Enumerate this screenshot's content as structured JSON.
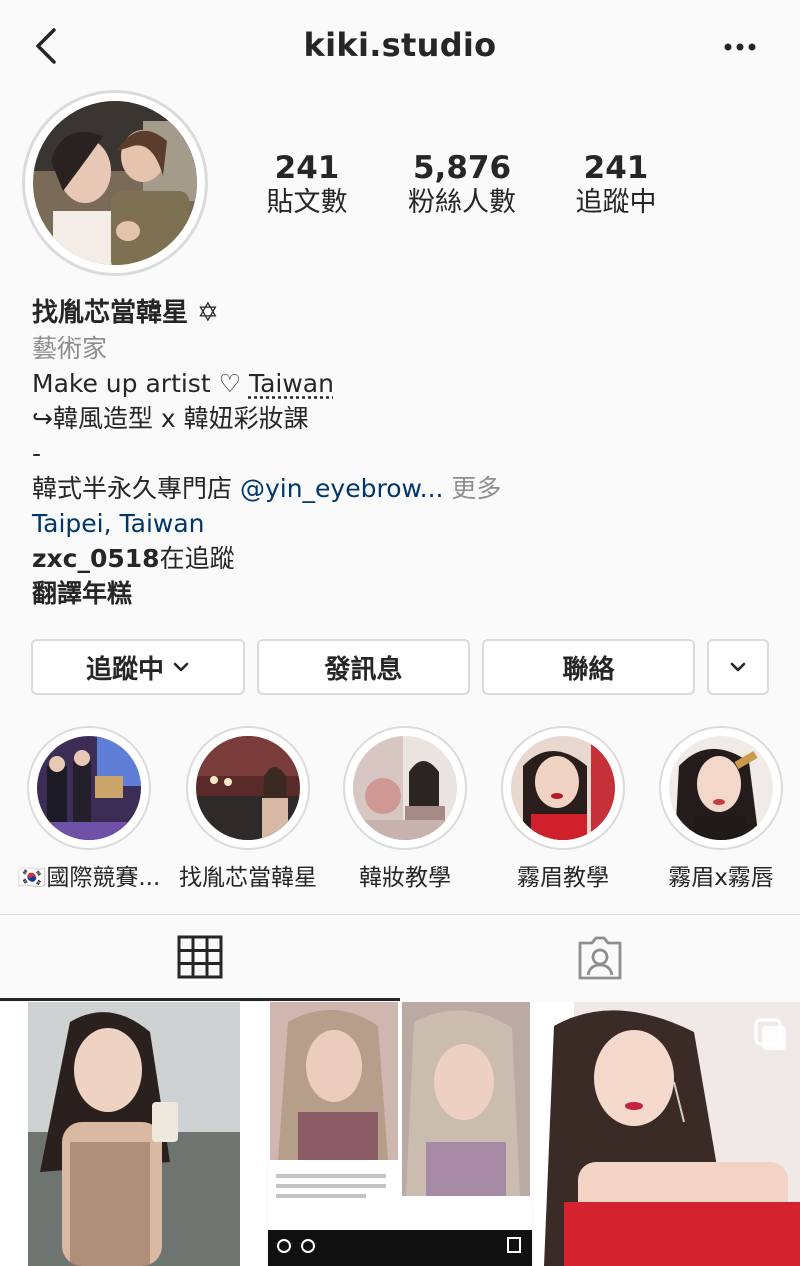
{
  "header": {
    "username": "kiki.studio"
  },
  "stats": [
    {
      "value": "241",
      "label": "貼文數"
    },
    {
      "value": "5,876",
      "label": "粉絲人數"
    },
    {
      "value": "241",
      "label": "追蹤中"
    }
  ],
  "bio": {
    "name": "找胤芯當韓星 ✡",
    "category": "藝術家",
    "line1_a": "Make up artist ♡ ",
    "line1_b": "Taiwan",
    "line2": "↪韓風造型 x 韓妞彩妝課",
    "line3": "-",
    "line4_a": " 韓式半永久專門店 ",
    "line4_mention": "@yin_eyebrow...",
    "line4_more": " 更多",
    "location": "Taipei, Taiwan",
    "followed_by_user": "zxc_0518",
    "followed_by_suffix": "在追蹤",
    "translate": "翻譯年糕"
  },
  "buttons": {
    "following": "追蹤中",
    "message": "發訊息",
    "contact": "聯絡"
  },
  "highlights": [
    {
      "label": "🇰🇷國際競賽..."
    },
    {
      "label": "找胤芯當韓星"
    },
    {
      "label": "韓妝教學"
    },
    {
      "label": "霧眉教學"
    },
    {
      "label": "霧眉x霧唇"
    }
  ],
  "tabs": {
    "active": "grid",
    "icons": [
      "grid-icon",
      "tagged-icon"
    ]
  },
  "colors": {
    "link": "#00376b",
    "muted": "#8e8e8e",
    "border": "#dbdbdb",
    "lipstick": "#d0202c"
  }
}
